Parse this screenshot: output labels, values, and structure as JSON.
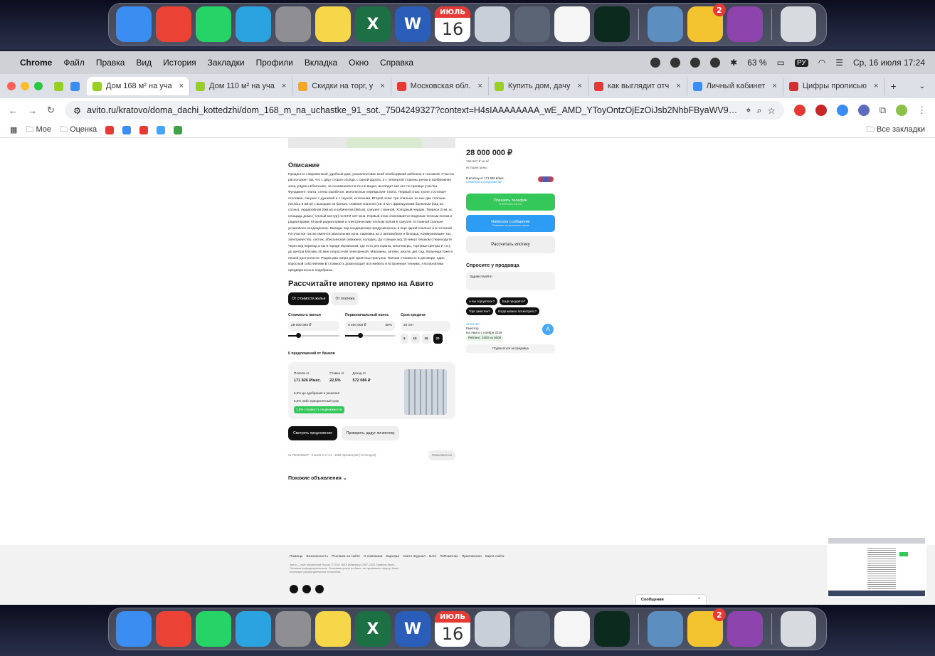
{
  "dock": {
    "apps": [
      {
        "name": "finder",
        "color": "#3b8df1",
        "glyph": ""
      },
      {
        "name": "chrome",
        "color": "#ea4335",
        "glyph": ""
      },
      {
        "name": "whatsapp",
        "color": "#25d366",
        "glyph": ""
      },
      {
        "name": "telegram",
        "color": "#2aa3e0",
        "glyph": ""
      },
      {
        "name": "system-settings",
        "color": "#8e8e93",
        "glyph": ""
      },
      {
        "name": "notes",
        "color": "#f7d74a",
        "glyph": ""
      },
      {
        "name": "excel",
        "color": "#1d7044",
        "glyph": "X"
      },
      {
        "name": "word",
        "color": "#2b5eb8",
        "glyph": "W"
      },
      {
        "name": "calendar",
        "color": "#ffffff",
        "glyph": ""
      },
      {
        "name": "launchpad",
        "color": "#c9cfd9",
        "glyph": ""
      },
      {
        "name": "iphone-mirroring",
        "color": "#5b6475",
        "glyph": ""
      },
      {
        "name": "chatgpt",
        "color": "#f5f5f5",
        "glyph": ""
      },
      {
        "name": "app-dark",
        "color": "#0c2a1e",
        "glyph": ""
      }
    ],
    "calendar_month": "ИЮЛЬ",
    "calendar_day": "16",
    "downloads_badge": "2"
  },
  "menubar": {
    "app": "Chrome",
    "items": [
      "Файл",
      "Правка",
      "Вид",
      "История",
      "Закладки",
      "Профили",
      "Вкладка",
      "Окно",
      "Справка"
    ],
    "battery": "63 %",
    "lang": "РУ",
    "datetime": "Ср, 16 июля 17:24"
  },
  "tabs": [
    {
      "label": "Дом 168 м² на уча",
      "favicon": "#97cf26",
      "active": true
    },
    {
      "label": "Дом 110 м² на уча",
      "favicon": "#97cf26",
      "active": false
    },
    {
      "label": "Скидки на торг, у",
      "favicon": "#f6a623",
      "active": false
    },
    {
      "label": "Московская обл.",
      "favicon": "#e53935",
      "active": false
    },
    {
      "label": "Купить дом, дачу",
      "favicon": "#97cf26",
      "active": false
    },
    {
      "label": "как выглядит отч",
      "favicon": "#e53935",
      "active": false
    },
    {
      "label": "Личный кабинет",
      "favicon": "#3b8df1",
      "active": false
    },
    {
      "label": "Цифры прописью",
      "favicon": "#d32f2f",
      "active": false
    }
  ],
  "address": {
    "url": "avito.ru/kratovo/doma_dachi_kottedzhi/dom_168_m_na_uchastke_91_sot._7504249327?context=H4sIAAAAAAAA_wE_AMD_YToyOntzOjEzOiJsb2NhbFByaWV9yaXR5IjtiOjE7c..."
  },
  "bookmarks": {
    "folders": [
      "Мое",
      "Оценка"
    ],
    "all": "Все закладки"
  },
  "listing": {
    "description_title": "Описание",
    "description": "Продается современный, удобный дом, укомплектован всей необходимой мебелью и техникой. Участок расположен так, что с двух сторон соседи, с одной дорога, а с четвертой стороны речка и прибрежная зона, рядом небольшие, за основанием почти не видно, выглядит как лес по границе участка. Фундамент плита, стены газобетон, монолитные перекрытия- плита. Первый этаж: кухня, гостиная- столовая, санузел с душевой и с сауной, котельная. Второй этаж: три спальни, из них две спальни (10,6/11,9 КВ.м) с выходом на балкон, главная спальня (15, 9 м) с французским балконом (вид на сосны), гардеробная (5кв.м) и кабинетом (8кв.м), санузел с ванной. Холодный чердак. Терраса 21кв. м, площадь дома ( теплый контур) по БТИ 147 кв.м. Первый этаж отапливается водяным теплым полом и радиаторами, второй радиаторами и электрическим теплым полом в санузле. В главной спальне установлен кондиционер. Выводы под кондиционер предусмотрены в ещё одной спальне и в гостиной. На участке так же имеется мангальная зона, парковка на 2 автомобиля и беседка. Коммуникации- газ, электричество, септик, абиссинская скважина, колодец. До станции ж/д 15 минут пешком ( переходите через ж/д переход и вы в городе Жуковском, где есть рестораны, кинотеатры, торговые центры и т.п.), до центра Москвы 40 мин скоростной электричкой. Магазины, аптеки, школа, дет сад, больница тоже в пешей доступности. Рядом два озера для приятных прогулок. Полная стоимость в договоре, один взрослый собственник.В стоимость дома входит вся мебель и встроенная техника. Альтернатива предварительно подобрана.",
    "mortgage_title": "Рассчитайте ипотеку прямо на Авито",
    "mortgage_tabs": [
      "От стоимости жилья",
      "От платежа"
    ],
    "fields": {
      "price_label": "Стоимость жилья",
      "price_value": "28 000 000 ₽",
      "down_label": "Первоначальный взнос",
      "down_value": "8 400 000 ₽",
      "down_pct": "30%",
      "term_label": "Срок кредита",
      "term_value": "20 лет",
      "price_slider": 0.2,
      "down_slider": 0.3
    },
    "terms": [
      "5",
      "10",
      "15",
      "20"
    ],
    "banks_title": "6 предложений от банков",
    "bank": {
      "payment_label": "Платёж от",
      "payment": "171 826 ₽/мес.",
      "rate_label": "Ставка от",
      "rate": "22,5%",
      "income_label": "Доход от",
      "income": "572 086 ₽",
      "note1": "6,5% до одобрения и решения",
      "note2": "6,5% либо приоритетный срок",
      "note3": "1,5% стоимость недвижимости"
    },
    "btn_offers": "Смотреть предложения",
    "btn_check": "Проверить, дадут ли ипотеку",
    "stats": "№ 7504249327 · 9 июля в 17:41 · 1069 просмотров (+8 сегодня)",
    "complain": "Пожаловаться",
    "similar": "Похожие объявления ⌄"
  },
  "sidebar": {
    "price": "28 000 000 ₽",
    "per_m2": "166 667 ₽ за м²",
    "price_history": "История цены",
    "mortgage_text": "В ипотеку от 171 826 ₽/мес.",
    "mortgage_link": "Посмотреть предложения",
    "phone_btn": "Показать телефон",
    "phone_sub": "8 9XX XXX-XX-XX",
    "msg_btn": "Написать сообщение",
    "msg_sub": "Отвечает за несколько часов",
    "calc_btn": "Рассчитать ипотеку",
    "ask_title": "Спросите у продавца",
    "ask_placeholder": "Здравствуйте!",
    "chips": [
      "А вы торгуетесь?",
      "Ещё продаёте?",
      "Торг уместен?",
      "Когда можно посмотреть?"
    ],
    "seller_type": "Агенство",
    "seller_name": "Риелтор",
    "seller_since": "На Авито с ноября 2019",
    "seller_rating": "Рейтинг: 1000 из 5000",
    "seller_avatar": "A",
    "subscribe": "Подписаться на продавца"
  },
  "footer": {
    "links": [
      "Помощь",
      "Безопасность",
      "Реклама на сайте",
      "О компании",
      "Карьера",
      "Авито Журнал",
      "Блог",
      "#яПомогаю",
      "Приложения",
      "Карта сайта"
    ],
    "legal": "Авито — сайт объявлений России. © ООО «КЕХ еКоммерц» 2007–2025. Правила Авито. Политика конфиденциальности. Оплачивая услуги на Авито, вы принимаете оферту. Авито использует рекомендательные технологии.",
    "messages": "Сообщения"
  }
}
